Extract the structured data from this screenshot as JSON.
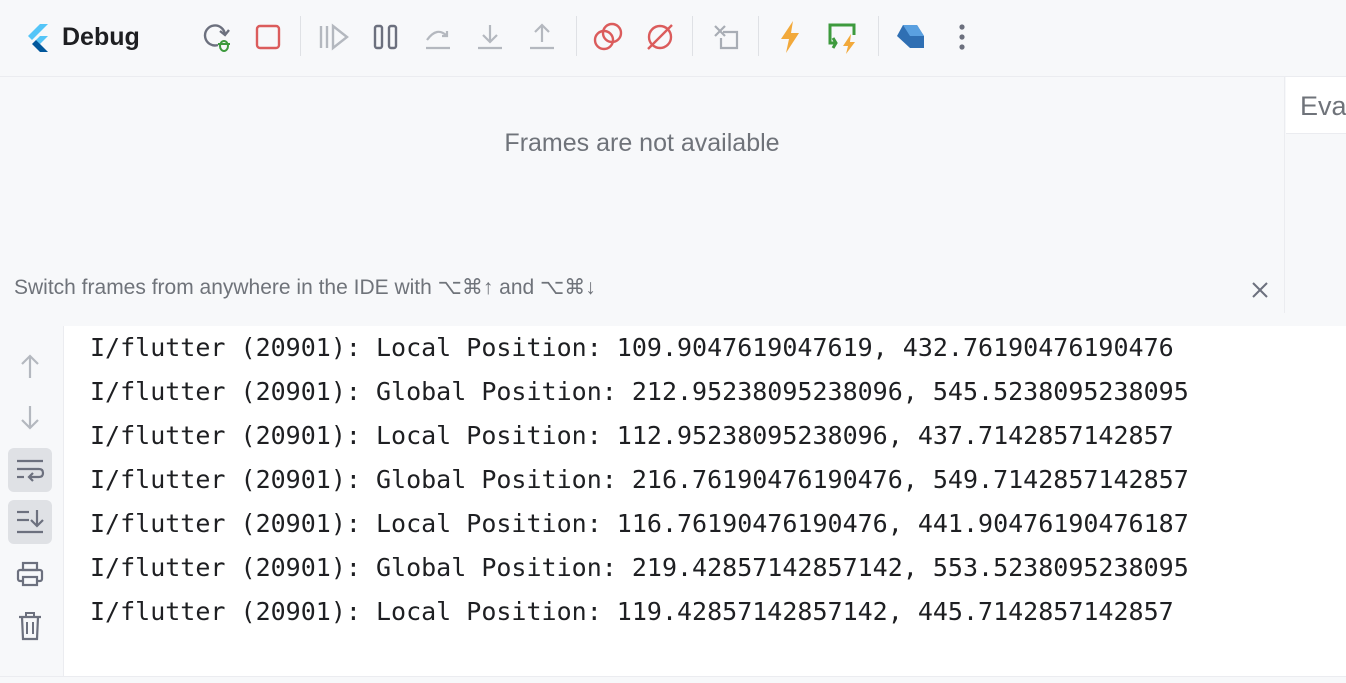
{
  "toolbar": {
    "title": "Debug",
    "icons": [
      "rerun-debug-icon",
      "stop-icon",
      "resume-icon",
      "pause-icon",
      "step-over-icon",
      "step-into-icon",
      "step-out-icon",
      "view-breakpoints-icon",
      "mute-breakpoints-icon",
      "restore-layout-icon",
      "hot-reload-icon",
      "hot-restart-icon",
      "dart-devtools-icon",
      "more-icon"
    ],
    "colors": {
      "stop": "#db5c5c",
      "hot_reload": "#f2a93b",
      "hot_restart": "#3d9a3d",
      "breakpoint": "#db5c5c",
      "disabled": "#b4b8bf",
      "dart": "#2f6fb3"
    }
  },
  "frames": {
    "empty_message": "Frames are not available",
    "hint": "Switch frames from anywhere in the IDE with ⌥⌘↑ and ⌥⌘↓"
  },
  "evaluate": {
    "placeholder": "Eva"
  },
  "console": {
    "lines": [
      "I/flutter (20901): Local Position: 109.9047619047619, 432.76190476190476",
      "I/flutter (20901): Global Position: 212.95238095238096, 545.5238095238095",
      "I/flutter (20901): Local Position: 112.95238095238096, 437.7142857142857",
      "I/flutter (20901): Global Position: 216.76190476190476, 549.7142857142857",
      "I/flutter (20901): Local Position: 116.76190476190476, 441.90476190476187",
      "I/flutter (20901): Global Position: 219.42857142857142, 553.5238095238095",
      "I/flutter (20901): Local Position: 119.42857142857142, 445.7142857142857"
    ]
  },
  "console_sidebar": {
    "icons": [
      "scroll-up-icon",
      "scroll-down-icon",
      "soft-wrap-icon",
      "scroll-to-end-icon",
      "print-icon",
      "clear-all-icon"
    ],
    "active": [
      "soft-wrap-icon",
      "scroll-to-end-icon"
    ]
  }
}
